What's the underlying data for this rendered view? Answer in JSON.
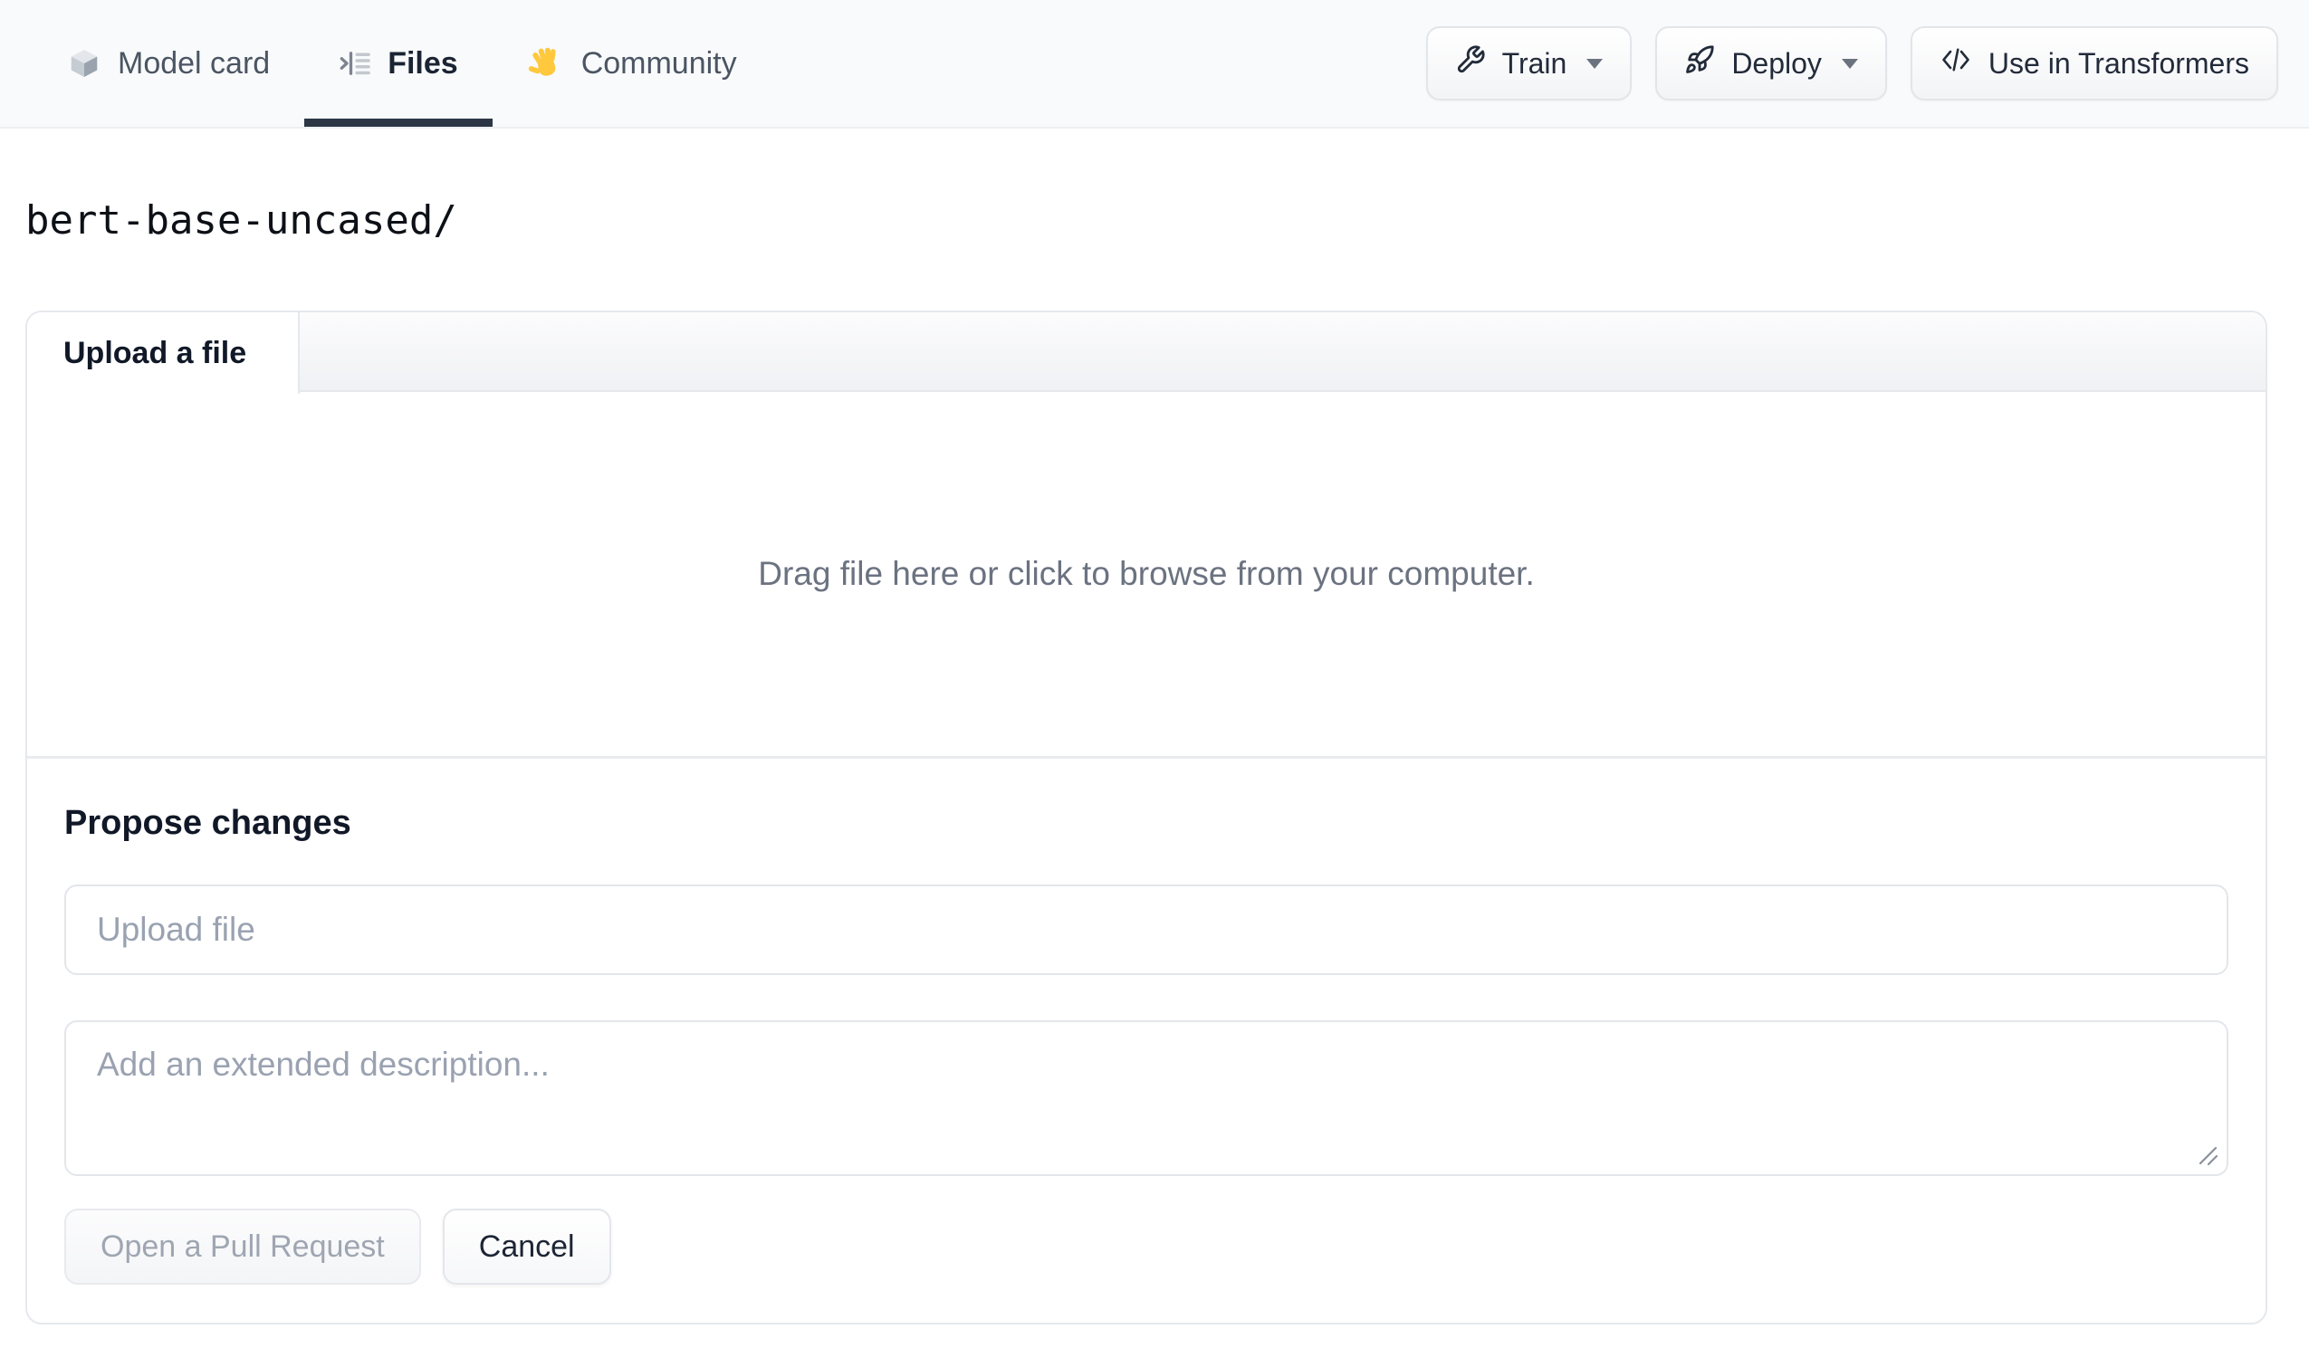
{
  "nav": {
    "tabs": [
      {
        "label": "Model card",
        "icon": "cube-icon",
        "active": false
      },
      {
        "label": "Files",
        "icon": "files-icon",
        "active": true
      },
      {
        "label": "Community",
        "icon": "waving-hand-icon",
        "active": false
      }
    ],
    "actions": [
      {
        "label": "Train",
        "icon": "wrench-icon",
        "has_caret": true
      },
      {
        "label": "Deploy",
        "icon": "rocket-icon",
        "has_caret": true
      },
      {
        "label": "Use in Transformers",
        "icon": "code-icon",
        "has_caret": false
      }
    ]
  },
  "breadcrumb": {
    "path": "bert-base-uncased/"
  },
  "upload_panel": {
    "tab_label": "Upload a file",
    "dropzone_text": "Drag file here or click to browse from your computer.",
    "propose": {
      "heading": "Propose changes",
      "filename_placeholder": "Upload file",
      "description_placeholder": "Add an extended description...",
      "submit_label": "Open a Pull Request",
      "cancel_label": "Cancel"
    }
  },
  "colors": {
    "active_tab_underline": "#2c3645",
    "nav_background": "#f9fafb",
    "hand_yellow": "#ffc83d",
    "panel_border": "#e5e8ec",
    "muted_text": "#6b7280",
    "placeholder_text": "#9aa2b1",
    "disabled_button_text": "#9fa6b2"
  }
}
